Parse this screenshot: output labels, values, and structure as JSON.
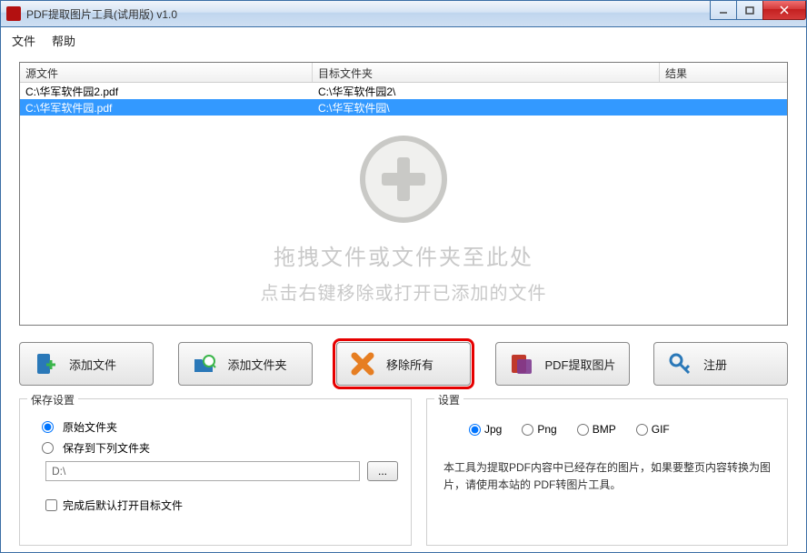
{
  "window": {
    "title": "PDF提取图片工具(试用版) v1.0"
  },
  "menu": {
    "file": "文件",
    "help": "帮助"
  },
  "table": {
    "headers": {
      "source": "源文件",
      "target": "目标文件夹",
      "result": "结果"
    },
    "rows": [
      {
        "source": "C:\\华军软件园2.pdf",
        "target": "C:\\华军软件园2\\",
        "result": "",
        "selected": false
      },
      {
        "source": "C:\\华军软件园.pdf",
        "target": "C:\\华军软件园\\",
        "result": "",
        "selected": true
      }
    ],
    "drop_hint": {
      "line1": "拖拽文件或文件夹至此处",
      "line2": "点击右键移除或打开已添加的文件"
    }
  },
  "toolbar": {
    "add_file": "添加文件",
    "add_folder": "添加文件夹",
    "remove_all": "移除所有",
    "extract": "PDF提取图片",
    "register": "注册"
  },
  "save_settings": {
    "legend": "保存设置",
    "opt_original": "原始文件夹",
    "opt_custom": "保存到下列文件夹",
    "path_value": "D:\\",
    "browse": "...",
    "open_after": "完成后默认打开目标文件",
    "selected": "original",
    "open_after_checked": false
  },
  "settings": {
    "legend": "设置",
    "formats": {
      "jpg": "Jpg",
      "png": "Png",
      "bmp": "BMP",
      "gif": "GIF"
    },
    "selected": "jpg",
    "desc": "本工具为提取PDF内容中已经存在的图片，如果要整页内容转换为图片，请使用本站的 PDF转图片工具。"
  }
}
